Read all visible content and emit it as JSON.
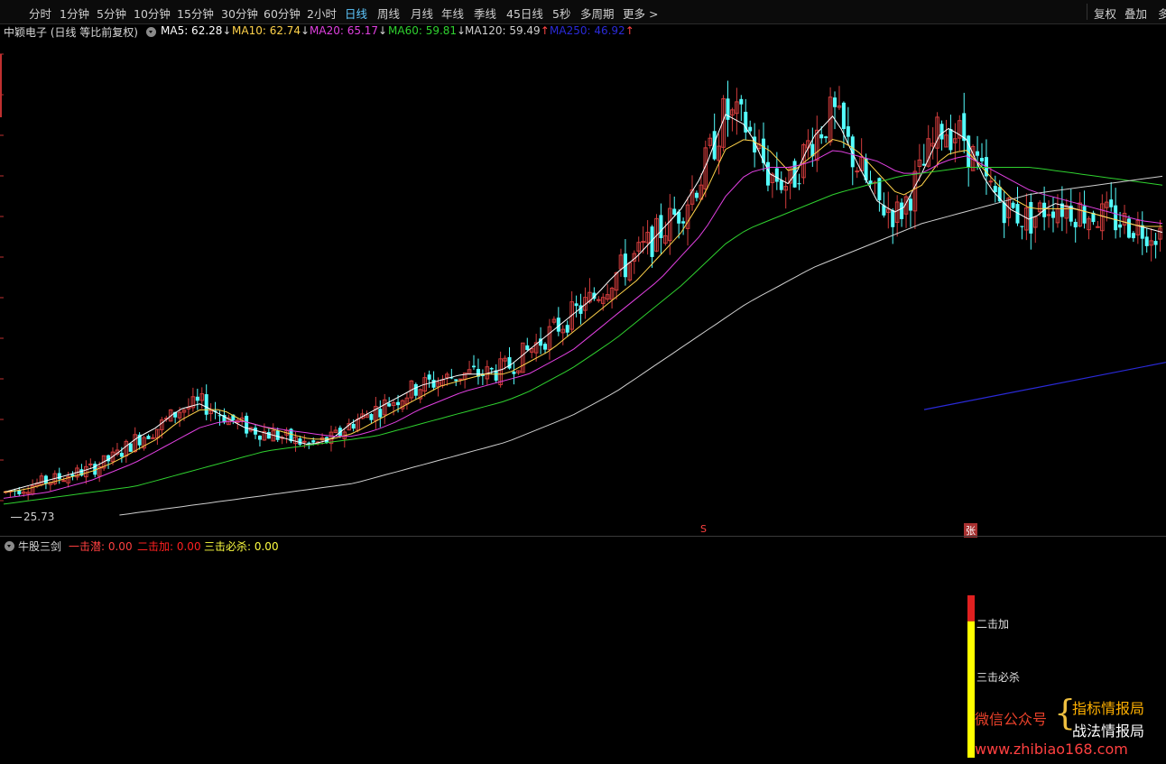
{
  "toolbar": {
    "periods": [
      "分时",
      "1分钟",
      "5分钟",
      "10分钟",
      "15分钟",
      "30分钟",
      "60分钟",
      "2小时",
      "日线",
      "周线",
      "月线",
      "年线",
      "季线",
      "45日线",
      "5秒",
      "多周期",
      "更多 >"
    ],
    "active_index": 8,
    "right": [
      "复权",
      "叠加",
      "多"
    ]
  },
  "legend": {
    "stock_title": "中颖电子 (日线 等比前复权)",
    "ma": [
      {
        "label": "MA5: 62.28",
        "arrow": "↓",
        "color": "#ffffff"
      },
      {
        "label": "MA10: 62.74",
        "arrow": "↓",
        "color": "#ffd24a"
      },
      {
        "label": "MA20: 65.17",
        "arrow": "↓",
        "color": "#e040e0"
      },
      {
        "label": "MA60: 59.81",
        "arrow": "↓",
        "color": "#2fd12f"
      },
      {
        "label": "MA120: 59.49",
        "arrow": "↑",
        "color": "#cfcfcf"
      },
      {
        "label": "MA250: 46.92",
        "arrow": "↑",
        "color": "#2a2ad8"
      }
    ]
  },
  "chart_labels": {
    "low_price": "25.73",
    "marker_s": "S",
    "marker_zhang": "张"
  },
  "indicator": {
    "name": "牛股三剑",
    "values": [
      {
        "label": "一击潜: 0.00",
        "color": "#ff4040"
      },
      {
        "label": "二击加: 0.00",
        "color": "#ff2020"
      },
      {
        "label": "三击必杀: 0.00",
        "color": "#ffff40"
      }
    ],
    "bar_labels": [
      "二击加",
      "三击必杀"
    ],
    "bar_fraction_red": 0.16,
    "bar_fraction_yellow": 0.84
  },
  "watermark": {
    "wechat": "微信公众号",
    "brace": "{",
    "account1": "指标情报局",
    "account2": "战法情报局",
    "url": "www.zhibiao168.com"
  },
  "colors": {
    "up": "#d23c3c",
    "down": "#54ffff",
    "ma5": "#ffffff",
    "ma10": "#ffd24a",
    "ma20": "#e040e0",
    "ma60": "#2fd12f",
    "ma120": "#cfcfcf",
    "ma250": "#2a2ad8"
  },
  "chart_data": {
    "type": "candlestick",
    "price_range": [
      25.73,
      102
    ],
    "low_marker": 25.73,
    "series": [
      {
        "name": "MA5",
        "values": [
          26,
          27,
          28,
          29,
          30,
          32,
          35,
          37,
          40,
          41,
          39,
          37,
          36,
          35,
          34,
          35,
          38,
          40,
          42,
          44,
          45,
          46,
          46,
          47,
          50,
          53,
          56,
          59,
          63,
          66,
          70,
          74,
          80,
          90,
          88,
          80,
          78,
          86,
          90,
          82,
          75,
          73,
          80,
          88,
          86,
          78,
          74,
          72,
          75,
          74,
          73,
          72,
          71,
          70
        ]
      },
      {
        "name": "MA10",
        "values": [
          26,
          26.5,
          27.5,
          28.5,
          29.5,
          31,
          33,
          35,
          38,
          40,
          40,
          38,
          37,
          36,
          35,
          35,
          36,
          38,
          40,
          42,
          44,
          45,
          46,
          46,
          48,
          50,
          53,
          56,
          59,
          62,
          66,
          70,
          76,
          84,
          86,
          84,
          80,
          83,
          86,
          84,
          80,
          76,
          78,
          83,
          84,
          80,
          76,
          74,
          74,
          74,
          73,
          72,
          71,
          71
        ]
      },
      {
        "name": "MA20",
        "values": [
          25,
          25.5,
          26,
          27,
          28,
          29.5,
          31,
          33,
          35,
          37,
          38,
          38,
          37,
          36.5,
          36,
          35.5,
          35.5,
          36.5,
          38,
          40,
          41.5,
          43,
          44,
          45,
          46,
          48,
          50,
          53,
          56,
          59,
          62,
          66,
          70,
          76,
          80,
          81,
          81,
          82,
          84,
          83,
          82,
          80,
          80,
          82,
          83,
          81,
          79,
          77,
          76,
          75,
          74,
          73,
          72,
          71.5
        ]
      },
      {
        "name": "MA60",
        "values": [
          24,
          24.5,
          25,
          25.5,
          26,
          26.5,
          27,
          28,
          29,
          30,
          31,
          32,
          33,
          33.5,
          34,
          34.5,
          35,
          35.5,
          36.5,
          37.5,
          38.5,
          39.5,
          40.5,
          41.5,
          43,
          45,
          47,
          49.5,
          52,
          55,
          58,
          61,
          64.5,
          68,
          70.5,
          72,
          73.5,
          75,
          76.5,
          77.5,
          78.5,
          79.5,
          80,
          80.5,
          81,
          81,
          81,
          81,
          80.5,
          80,
          79.5,
          79,
          78.5,
          78
        ]
      },
      {
        "name": "MA120",
        "values": [
          null,
          null,
          null,
          null,
          null,
          22,
          22.5,
          23,
          23.5,
          24,
          24.5,
          25,
          25.5,
          26,
          26.5,
          27,
          27.5,
          28.5,
          29.5,
          30.5,
          31.5,
          32.5,
          33.5,
          34.5,
          36,
          37.5,
          39,
          41,
          43,
          45.5,
          48,
          50.5,
          53,
          55.5,
          58,
          60,
          62,
          64,
          65.5,
          67,
          68.5,
          70,
          71.5,
          72.5,
          73.5,
          74.5,
          75.5,
          76.5,
          77,
          77.5,
          78,
          78.5,
          79,
          79.5
        ]
      },
      {
        "name": "MA250",
        "values": [
          {
            "x": 1024,
            "y": 40
          },
          {
            "x": 1292,
            "y": 48
          }
        ]
      }
    ]
  }
}
